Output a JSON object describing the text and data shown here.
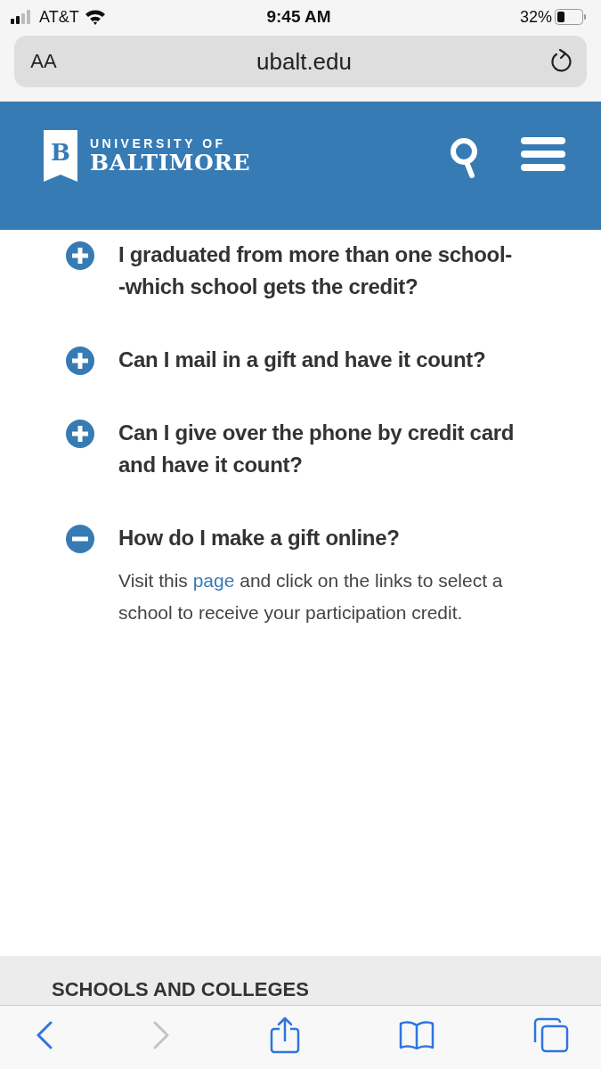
{
  "status_bar": {
    "carrier": "AT&T",
    "time": "9:45 AM",
    "battery": "32%"
  },
  "address_bar": {
    "text_size_button": "AA",
    "url": "ubalt.edu"
  },
  "header": {
    "logo_mark": "B",
    "logo_top": "UNIVERSITY OF",
    "logo_bottom": "BALTIMORE"
  },
  "faq": [
    {
      "question": "I graduated from more than one school--which school gets the credit?",
      "expanded": false
    },
    {
      "question": "Can I mail in a gift and have it count?",
      "expanded": false
    },
    {
      "question": "Can I give over the phone by credit card and have it count?",
      "expanded": false
    },
    {
      "question": "How do I make a gift online?",
      "expanded": true,
      "answer": {
        "before": "Visit this ",
        "link": "page",
        "after": " and click on the links to select a school to receive your participation credit."
      }
    }
  ],
  "footer": {
    "heading": "SCHOOLS AND COLLEGES"
  },
  "toolbar": [
    {
      "kind": "back",
      "disabled": false
    },
    {
      "kind": "forward",
      "disabled": true
    },
    {
      "kind": "share",
      "disabled": false
    },
    {
      "kind": "bookmarks",
      "disabled": false
    },
    {
      "kind": "tabs",
      "disabled": false
    }
  ]
}
